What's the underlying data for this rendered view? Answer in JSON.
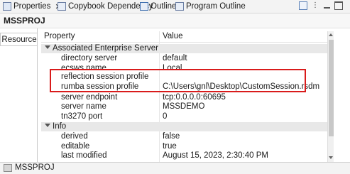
{
  "tabs": [
    {
      "label": "Properties",
      "icon": "properties-icon",
      "active": true
    },
    {
      "label": "Copybook Dependency",
      "icon": "copybook-icon"
    },
    {
      "label": "Outline",
      "icon": "outline-icon"
    },
    {
      "label": "Program Outline",
      "icon": "program-outline-icon"
    }
  ],
  "toolbar": {
    "icons": [
      "new-editor-icon",
      "view-menu-icon",
      "minimize-icon",
      "maximize-icon"
    ]
  },
  "header": {
    "title": "MSSPROJ"
  },
  "sidebar": {
    "tab_label": "Resource"
  },
  "table": {
    "columns": {
      "property": "Property",
      "value": "Value"
    },
    "categories": [
      {
        "label": "Associated Enterprise Server",
        "rows": [
          {
            "key": "directory server",
            "value": "default"
          },
          {
            "key": "ecsws name",
            "value": "Local"
          },
          {
            "key": "reflection session profile",
            "value": ""
          },
          {
            "key": "rumba session profile",
            "value": "C:\\Users\\gnl\\Desktop\\CustomSession.rsdm"
          },
          {
            "key": "server endpoint",
            "value": "tcp:0.0.0.0:60695"
          },
          {
            "key": "server name",
            "value": "MSSDEMO"
          },
          {
            "key": "tn3270 port",
            "value": "0"
          }
        ]
      },
      {
        "label": "Info",
        "rows": [
          {
            "key": "derived",
            "value": "false"
          },
          {
            "key": "editable",
            "value": "true"
          },
          {
            "key": "last modified",
            "value": "August 15, 2023, 2:30:40 PM"
          }
        ]
      }
    ]
  },
  "status": {
    "label": "MSSPROJ"
  },
  "colors": {
    "highlight": "#d91b1b",
    "category_bg": "#e8e8e8"
  }
}
